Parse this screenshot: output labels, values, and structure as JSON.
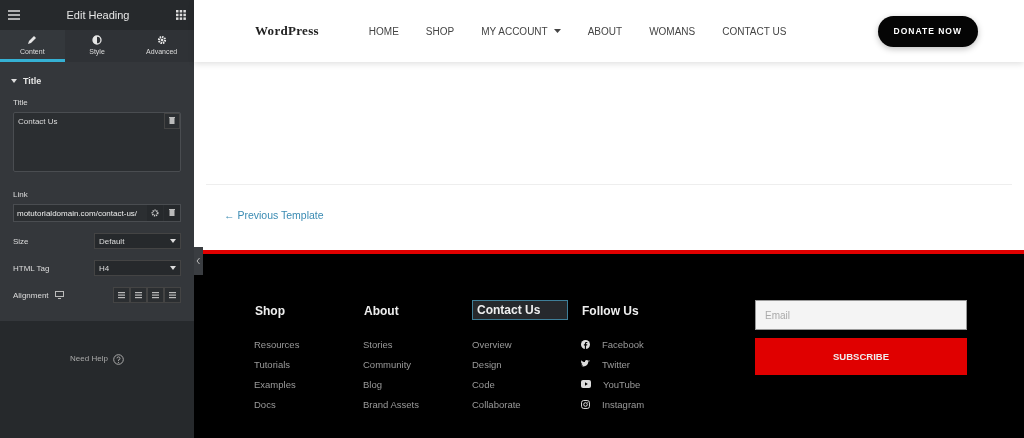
{
  "editor": {
    "title": "Edit Heading",
    "tabs": [
      {
        "label": "Content",
        "selected": true
      },
      {
        "label": "Style",
        "selected": false
      },
      {
        "label": "Advanced",
        "selected": false
      }
    ],
    "section": {
      "title": "Title",
      "expanded": true
    },
    "title_field": {
      "label": "Title",
      "value": "Contact Us"
    },
    "link_field": {
      "label": "Link",
      "value": "motutorialdomain.com/contact-us/"
    },
    "selects": [
      {
        "label": "Size",
        "value": "Default"
      },
      {
        "label": "HTML Tag",
        "value": "H4"
      }
    ],
    "alignment": {
      "label": "Alignment"
    },
    "help": "Need Help"
  },
  "site": {
    "logo": "WordPress",
    "nav": [
      {
        "label": "HOME",
        "dropdown": false
      },
      {
        "label": "SHOP",
        "dropdown": false
      },
      {
        "label": "MY ACCOUNT",
        "dropdown": true
      },
      {
        "label": "ABOUT",
        "dropdown": false
      },
      {
        "label": "WOMANS",
        "dropdown": false
      },
      {
        "label": "CONTACT US",
        "dropdown": false
      }
    ],
    "donate": "DONATE NOW",
    "previous": "← Previous Template",
    "footer": {
      "columns": [
        {
          "heading": "Shop",
          "selected": false,
          "links": [
            {
              "label": "Resources"
            },
            {
              "label": "Tutorials"
            },
            {
              "label": "Examples"
            },
            {
              "label": "Docs"
            }
          ]
        },
        {
          "heading": "About",
          "selected": false,
          "links": [
            {
              "label": "Stories"
            },
            {
              "label": "Community"
            },
            {
              "label": "Blog"
            },
            {
              "label": "Brand Assets"
            }
          ]
        },
        {
          "heading": "Contact Us",
          "selected": true,
          "links": [
            {
              "label": "Overview"
            },
            {
              "label": "Design"
            },
            {
              "label": "Code"
            },
            {
              "label": "Collaborate"
            }
          ]
        },
        {
          "heading": "Follow Us",
          "selected": false,
          "links": [
            {
              "label": "Facebook"
            },
            {
              "label": "Twitter"
            },
            {
              "label": "YouTube"
            },
            {
              "label": "Instagram"
            }
          ]
        }
      ],
      "email": {
        "placeholder": "Email"
      },
      "subscribe": "SUBSCRIBE"
    }
  }
}
